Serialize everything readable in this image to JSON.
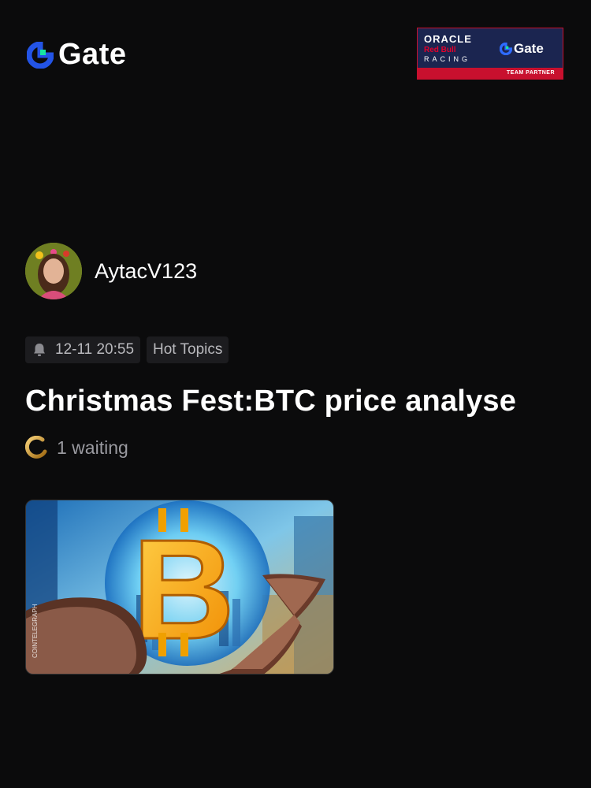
{
  "header": {
    "logo_text": "Gate",
    "partner": {
      "oracle": "ORACLE",
      "redbull": "Red Bull",
      "racing": "RACING",
      "gate": "Gate",
      "band": "TEAM PARTNER"
    }
  },
  "post": {
    "author": "AytacV123",
    "timestamp": "12-11 20:55",
    "topic": "Hot Topics",
    "title": "Christmas Fest:BTC price analyse",
    "waiting": "1 waiting",
    "image_watermark": "COINTELEGRAPH"
  },
  "colors": {
    "background": "#0b0b0c",
    "brand_blue": "#2354e6",
    "brand_green": "#17e6a1",
    "partner_navy": "#1b2550",
    "partner_red": "#c8102e",
    "tag_bg": "#1c1c1f",
    "muted_text": "#9a9aa0"
  }
}
